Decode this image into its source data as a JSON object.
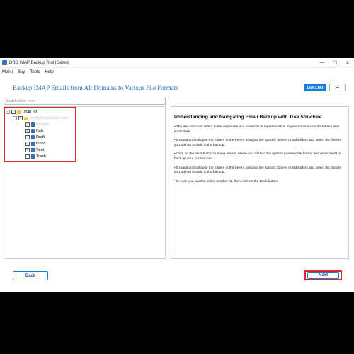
{
  "window": {
    "title": "DRS IMAP Backup Tool (Demo)",
    "controls": [
      "—",
      "☐",
      "✕"
    ]
  },
  "menubar": [
    "Menu",
    "Buy",
    "Tools",
    "Help"
  ],
  "header": {
    "title": "Backup IMAP Emails from All Domains to Various File Formats",
    "live_chat": "Live Chat",
    "menu_glyph": "☰"
  },
  "search": {
    "placeholder": "Search folder here"
  },
  "tree": {
    "root": "Imap_Id",
    "account": "sim8@mydomain.com",
    "folders": [
      "Archive",
      "Bulk",
      "Draft",
      "Inbox",
      "Sent",
      "Trash"
    ],
    "check_glyph": "✓",
    "collapse_glyph": "−"
  },
  "info": {
    "title": "Understanding and Navigating Email Backup with Tree Structure",
    "items": [
      "The tree structure refers to the organized and hierarchical representation of your email account's folders and subfolders.",
      "Expand and collapse the folders in the tree to navigate the specific folders or subfolders and select the folders you wish to include in the backup.",
      "Click on the Next button to move ahead, where you will find the options to select file format and email client to back up your source data.",
      "Expand and collapse the folders in the tree to navigate the specific folders or subfolders and select the folders you wish to include in the backup.",
      "In case you want to select another ID, then click on the Back button."
    ],
    "bullet": "•"
  },
  "buttons": {
    "back": "Back",
    "next": "Next"
  },
  "colors": {
    "accent": "#1f7ad6",
    "highlight": "#d6262e",
    "title": "#2a73c0"
  }
}
